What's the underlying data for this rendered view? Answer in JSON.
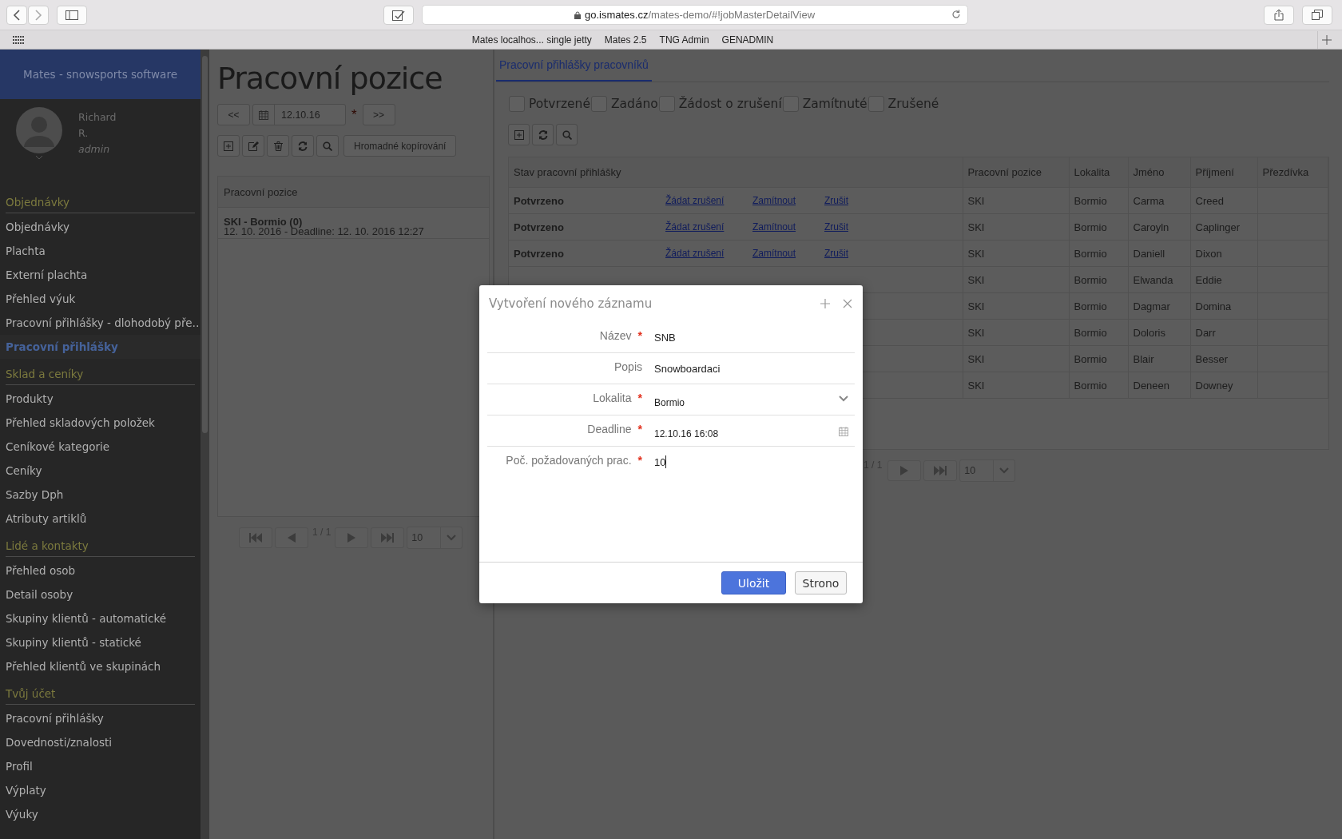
{
  "browser": {
    "url_domain": "go.ismates.cz",
    "url_path": "/mates-demo/#!jobMasterDetailView",
    "bookmarks": [
      "Mates localhos... single jetty",
      "Mates 2.5",
      "TNG Admin",
      "GENADMIN"
    ]
  },
  "sidebar": {
    "app_title": "Mates - snowsports software",
    "user": {
      "first_name": "Richard",
      "last_name": "R.",
      "role": "admin"
    },
    "sections": [
      {
        "title": "Objednávky",
        "items": [
          {
            "label": "Objednávky",
            "selected": false
          },
          {
            "label": "Plachta",
            "selected": false
          },
          {
            "label": "Externí plachta",
            "selected": false
          },
          {
            "label": "Přehled výuk",
            "selected": false
          },
          {
            "label": "Pracovní přihlášky - dlohodobý pře…",
            "selected": false
          },
          {
            "label": "Pracovní přihlášky",
            "selected": true
          }
        ]
      },
      {
        "title": "Sklad a ceníky",
        "items": [
          {
            "label": "Produkty",
            "selected": false
          },
          {
            "label": "Přehled skladových položek",
            "selected": false
          },
          {
            "label": "Ceníkové kategorie",
            "selected": false
          },
          {
            "label": "Ceníky",
            "selected": false
          },
          {
            "label": "Sazby Dph",
            "selected": false
          },
          {
            "label": "Atributy artiklů",
            "selected": false
          }
        ]
      },
      {
        "title": "Lidé a kontakty",
        "items": [
          {
            "label": "Přehled osob",
            "selected": false
          },
          {
            "label": "Detail osoby",
            "selected": false
          },
          {
            "label": "Skupiny klientů - automatické",
            "selected": false
          },
          {
            "label": "Skupiny klientů - statické",
            "selected": false
          },
          {
            "label": "Přehled klientů ve skupinách",
            "selected": false
          }
        ]
      },
      {
        "title": "Tvůj účet",
        "items": [
          {
            "label": "Pracovní přihlášky",
            "selected": false
          },
          {
            "label": "Dovednosti/znalosti",
            "selected": false
          },
          {
            "label": "Profil",
            "selected": false
          },
          {
            "label": "Výplaty",
            "selected": false
          },
          {
            "label": "Výuky",
            "selected": false
          }
        ]
      }
    ]
  },
  "positions_panel": {
    "title": "Pracovní pozice",
    "prev_label": "<<",
    "date": "12.10.16",
    "required_mark": "*",
    "next_label": ">>",
    "copy_button": "Hromadné kopírování",
    "list_header": "Pracovní pozice",
    "items": [
      {
        "title": "SKI - Bormio (0)",
        "subtitle": "12. 10. 2016 - Deadline: 12. 10. 2016 12:27"
      }
    ],
    "pager": {
      "page": "1 / 1",
      "page_size": "10"
    }
  },
  "applications_panel": {
    "tabs": [
      {
        "label": "Pracovní přihlášky pracovníků",
        "selected": true
      }
    ],
    "filters": [
      {
        "label": "Potvrzené",
        "checked": false
      },
      {
        "label": "Zadáno",
        "checked": false
      },
      {
        "label": "Žádost o zrušení",
        "checked": false
      },
      {
        "label": "Zamítnuté",
        "checked": false
      },
      {
        "label": "Zrušené",
        "checked": false
      }
    ],
    "table": {
      "columns": [
        "Stav pracovní přihlášky",
        "Pracovní pozice",
        "Lokalita",
        "Jméno",
        "Příjmení",
        "Přezdívka"
      ],
      "rows": [
        {
          "status": "Potvrzeno",
          "actions": [
            "Žádat zrušení",
            "Zamítnout",
            "Zrušit"
          ],
          "position": "SKI",
          "locality": "Bormio",
          "first_name": "Carma",
          "last_name": "Creed"
        },
        {
          "status": "Potvrzeno",
          "actions": [
            "Žádat zrušení",
            "Zamítnout",
            "Zrušit"
          ],
          "position": "SKI",
          "locality": "Bormio",
          "first_name": "Caroyln",
          "last_name": "Caplinger"
        },
        {
          "status": "Potvrzeno",
          "actions": [
            "Žádat zrušení",
            "Zamítnout",
            "Zrušit"
          ],
          "position": "SKI",
          "locality": "Bormio",
          "first_name": "Daniell",
          "last_name": "Dixon"
        },
        {
          "position": "SKI",
          "locality": "Bormio",
          "first_name": "Elwanda",
          "last_name": "Eddie"
        },
        {
          "position": "SKI",
          "locality": "Bormio",
          "first_name": "Dagmar",
          "last_name": "Domina"
        },
        {
          "position": "SKI",
          "locality": "Bormio",
          "first_name": "Doloris",
          "last_name": "Darr"
        },
        {
          "position": "SKI",
          "locality": "Bormio",
          "first_name": "Blair",
          "last_name": "Besser"
        },
        {
          "position": "SKI",
          "locality": "Bormio",
          "first_name": "Deneen",
          "last_name": "Downey"
        }
      ]
    },
    "pager": {
      "page": "1 / 1",
      "page_size": "10"
    }
  },
  "dialog": {
    "title": "Vytvoření nového záznamu",
    "fields": [
      {
        "kind": "text",
        "label": "Název",
        "required": true,
        "value": "SNB",
        "focused": false
      },
      {
        "kind": "text",
        "label": "Popis",
        "required": false,
        "value": "Snowboardaci",
        "focused": false
      },
      {
        "kind": "select",
        "label": "Lokalita",
        "required": true,
        "value": "Bormio",
        "focused": false
      },
      {
        "kind": "date",
        "label": "Deadline",
        "required": true,
        "value": "12.10.16 16:08",
        "focused": false
      },
      {
        "kind": "text",
        "label": "Poč. požadovaných prac.",
        "required": true,
        "value": "10",
        "focused": true
      }
    ],
    "required_mark": "*",
    "buttons": [
      {
        "kind": "primary",
        "label": "Uložit"
      },
      {
        "kind": "secondary",
        "label": "Strono"
      }
    ]
  }
}
